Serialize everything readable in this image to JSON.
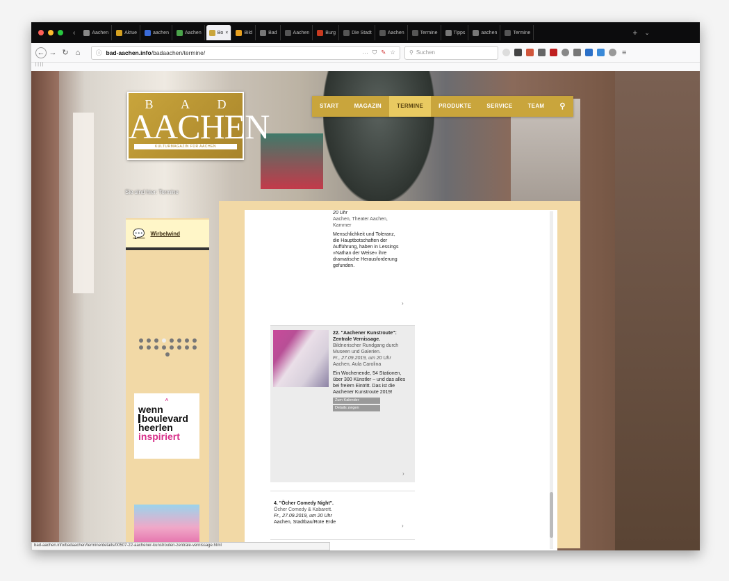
{
  "browser": {
    "tabs": [
      {
        "label": "Aachen",
        "color": "#888"
      },
      {
        "label": "Aktue",
        "color": "#d4a020"
      },
      {
        "label": "aachen",
        "color": "#3a6bd8"
      },
      {
        "label": "Aachen",
        "color": "#4aa34a"
      },
      {
        "label": "Bo",
        "color": "#c9a53c",
        "active": true
      },
      {
        "label": "Bild",
        "color": "#e8a020"
      },
      {
        "label": "Bad",
        "color": "#777"
      },
      {
        "label": "Aachen",
        "color": "#555"
      },
      {
        "label": "Burg",
        "color": "#c83a20"
      },
      {
        "label": "Die Stadt",
        "color": "#555"
      },
      {
        "label": "Aachen",
        "color": "#555"
      },
      {
        "label": "Termine",
        "color": "#555"
      },
      {
        "label": "Tipps",
        "color": "#777"
      },
      {
        "label": "aachen",
        "color": "#777"
      },
      {
        "label": "Termine",
        "color": "#555"
      }
    ],
    "url_host": "bad-aachen.info",
    "url_path": "/badaachen/termine/",
    "search_placeholder": "Suchen",
    "bookmarks_text": "| | | |",
    "status_text": "bad-aachen.info/badaachen/termine/details/00507-22-aachener-kunstrouten-zentrale-vernissage.html"
  },
  "site": {
    "logo_top": "B A D",
    "logo_main": "AACHEN",
    "logo_sub": "KULTURMAGAZIN FÜR AACHEN",
    "nav": [
      "START",
      "MAGAZIN",
      "TERMINE",
      "PRODUKTE",
      "SERVICE",
      "TEAM"
    ],
    "nav_search_icon": "search-icon",
    "breadcrumb": "Sie sind hier: Termine",
    "sidebar_title": "Wirbelwind",
    "ad_lines": [
      "wenn",
      "boulevard",
      "heerlen",
      "inspiriert"
    ]
  },
  "events": [
    {
      "date_tail": "20 Uhr",
      "place": "Aachen, Theater Aachen, Kammer",
      "teaser": "Menschlichkeit und Toleranz, die Hauptbotschaften der Aufführung, haben in Lessings »Nathan der Weise« ihre dramatische Herausforderung gefunden."
    },
    {
      "title": "22. \"Aachener Kunstroute\": Zentrale Vernissage.",
      "subtitle": "Bildnerischer Rundgang durch Museen und Galerien.",
      "date": "Fr., 27.09.2019, um 20 Uhr",
      "place": "Aachen, Aula Carolina",
      "teaser": "Ein Wochenende, 54 Stationen, über 300 Künstler – und das alles bei freiem Eintritt. Das ist die Aachener Kunstroute 2019!",
      "btn1": "Zum Kalender",
      "btn2": "Details zeigen"
    },
    {
      "title": "4. \"Öcher Comedy Night\".",
      "subtitle": "Öcher Comedy & Kabarett.",
      "date": "Fr., 27.09.2019, um 20 Uhr",
      "place": "Aachen, Stadtbau/Rote Erde"
    }
  ]
}
